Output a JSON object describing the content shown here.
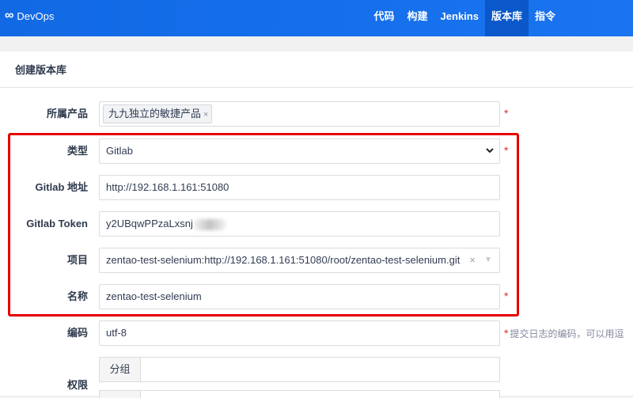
{
  "app": {
    "brand": "DevOps",
    "logo_icon": "infinity-icon"
  },
  "nav": {
    "items": [
      {
        "label": "代码"
      },
      {
        "label": "构建"
      },
      {
        "label": "Jenkins"
      },
      {
        "label": "版本库",
        "active": true
      },
      {
        "label": "指令"
      }
    ]
  },
  "page": {
    "title": "创建版本库"
  },
  "form": {
    "product": {
      "label": "所属产品",
      "chip": "九九独立的敏捷产品",
      "chip_remove": "×"
    },
    "type": {
      "label": "类型",
      "value": "Gitlab",
      "options": [
        "Gitlab"
      ]
    },
    "gitlab_url": {
      "label": "Gitlab 地址",
      "value": "http://192.168.1.161:51080"
    },
    "gitlab_token": {
      "label": "Gitlab Token",
      "value": "y2UBqwPPzaLxsnj"
    },
    "project": {
      "label": "项目",
      "value": "zentao-test-selenium:http://192.168.1.161:51080/root/zentao-test-selenium.git",
      "clear": "×",
      "caret": "▼"
    },
    "name": {
      "label": "名称",
      "value": "zentao-test-selenium"
    },
    "encoding": {
      "label": "编码",
      "value": "utf-8",
      "hint": "提交日志的编码，可以用逗"
    },
    "permission": {
      "label": "权限",
      "group_addon": "分组"
    },
    "required_mark": "*"
  },
  "colors": {
    "nav_bg": "#1a74f0",
    "nav_active": "#0a58c9",
    "required": "#e02c2c",
    "highlight": "#e60000"
  }
}
